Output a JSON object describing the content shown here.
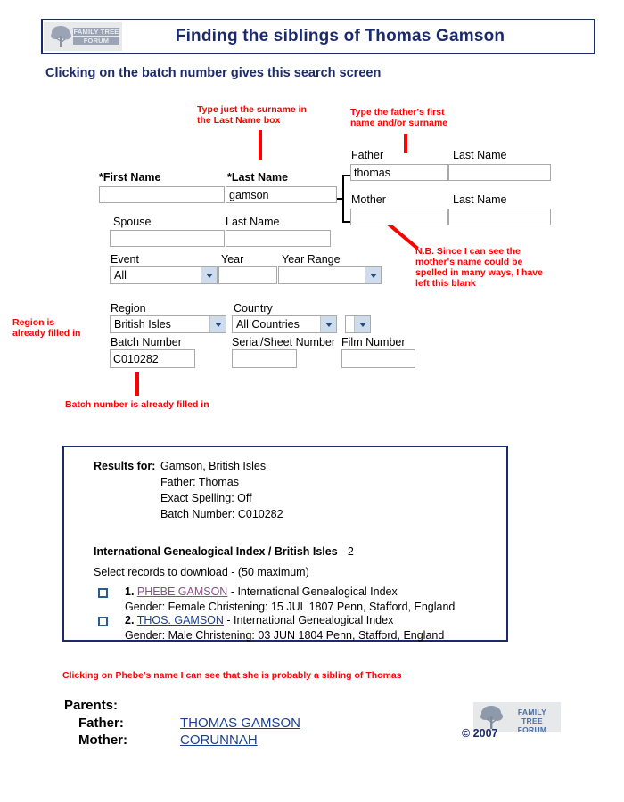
{
  "header": {
    "title": "Finding the siblings of Thomas Gamson",
    "logo_line1": "FAMILY TREE",
    "logo_line2": "FORUM"
  },
  "subtitle": "Clicking on the batch number gives this search screen",
  "annotations": {
    "surname": "Type just the surname in\nthe Last Name box",
    "father": "Type the father's first\nname and/or surname",
    "mother_nb": "N.B. Since I can see the\nmother's name could be\nspelled in many ways, I have\nleft this blank",
    "region": "Region is\nalready filled in",
    "batch": "Batch number is already filled in",
    "phebe": "Clicking on Phebe's name I can see that she is probably a sibling of Thomas"
  },
  "form": {
    "first_name_label": "*First Name",
    "first_name_value": "",
    "last_name_label": "*Last Name",
    "last_name_value": "gamson",
    "spouse_label": "Spouse",
    "spouse_value": "",
    "spouse_last_label": "Last Name",
    "spouse_last_value": "",
    "event_label": "Event",
    "event_value": "All",
    "year_label": "Year",
    "year_value": "",
    "year_range_label": "Year Range",
    "year_range_value": "",
    "father_label": "Father",
    "father_value": "thomas",
    "father_last_label": "Last Name",
    "father_last_value": "",
    "mother_label": "Mother",
    "mother_value": "",
    "mother_last_label": "Last Name",
    "mother_last_value": "",
    "region_label": "Region",
    "region_value": "British Isles",
    "country_label": "Country",
    "country_value": "All Countries",
    "extra_select_value": "",
    "batch_label": "Batch Number",
    "batch_value": "C010282",
    "serial_label": "Serial/Sheet Number",
    "serial_value": "",
    "film_label": "Film Number",
    "film_value": ""
  },
  "results": {
    "results_for_label": "Results for:",
    "summary": [
      "Gamson, British Isles",
      "Father: Thomas",
      "Exact Spelling: Off",
      "Batch Number: C010282"
    ],
    "index_heading": "International Genealogical Index / British Isles",
    "index_count": "- 2",
    "select_note": "Select records to download - (50 maximum)",
    "records": [
      {
        "num": "1.",
        "name": "PHEBE GAMSON",
        "source": "- International Genealogical Index",
        "detail": "Gender: Female Christening: 15 JUL 1807 Penn, Stafford, England",
        "visited": true
      },
      {
        "num": "2.",
        "name": "THOS. GAMSON",
        "source": "- International Genealogical Index",
        "detail": "Gender: Male Christening: 03 JUN 1804 Penn, Stafford, England",
        "visited": false
      }
    ]
  },
  "parents": {
    "heading": "Parents:",
    "father_label": "Father:",
    "father_name": "THOMAS GAMSON",
    "mother_label": "Mother:",
    "mother_name": "CORUNNAH"
  },
  "footer": {
    "logo_line1": "FAMILY TREE",
    "logo_line2": "FORUM",
    "copyright": "© 2007"
  }
}
